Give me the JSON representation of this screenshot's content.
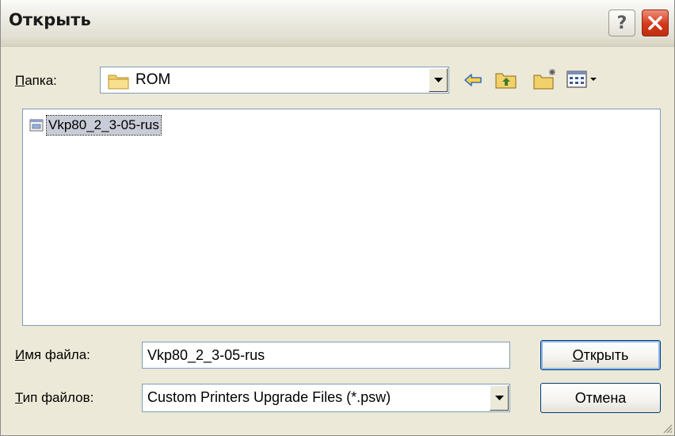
{
  "window": {
    "title": "Открыть",
    "help_button": "?"
  },
  "look_in": {
    "label_prefix": "П",
    "label_rest": "апка:",
    "folder": "ROM"
  },
  "toolbar": {
    "icons": [
      "back-arrow-icon",
      "up-folder-icon",
      "new-folder-icon",
      "view-menu-icon"
    ]
  },
  "files": [
    {
      "name": "Vkp80_2_3-05-rus",
      "selected": true
    }
  ],
  "filename": {
    "label_prefix": "И",
    "label_rest": "мя файла:",
    "value": "Vkp80_2_3-05-rus"
  },
  "filetype": {
    "label_prefix": "Т",
    "label_rest": "ип файлов:",
    "value": "Custom Printers Upgrade Files (*.psw)"
  },
  "buttons": {
    "open_prefix": "О",
    "open_rest": "ткрыть",
    "cancel": "Отмена"
  },
  "colors": {
    "selection": "#c8ccd6",
    "field_border": "#7f9db9",
    "dialog_bg": "#ece9d8"
  }
}
